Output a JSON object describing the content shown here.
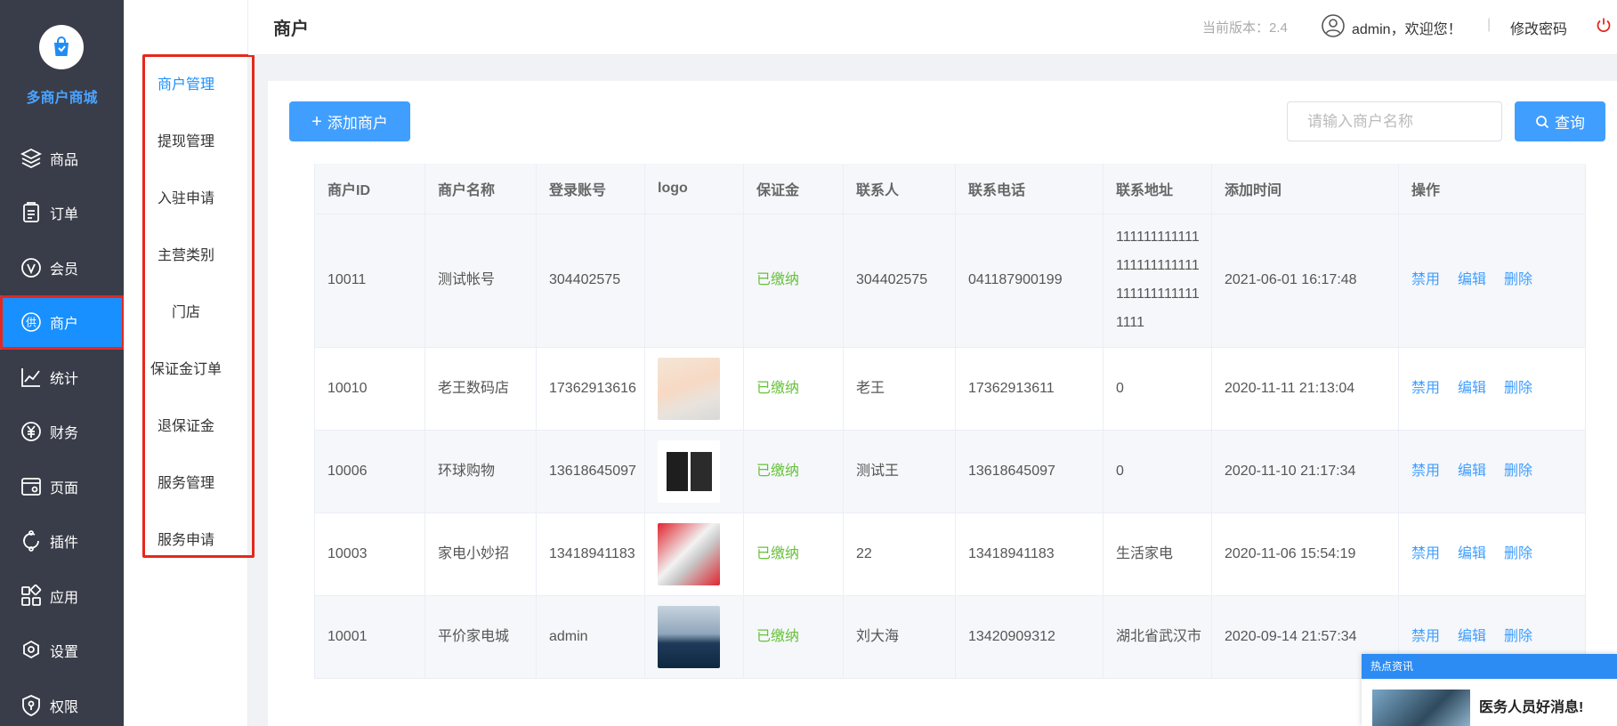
{
  "app": {
    "title": "多商户商城"
  },
  "sidebar": {
    "items": [
      {
        "label": "商品",
        "icon": "layers-icon"
      },
      {
        "label": "订单",
        "icon": "clipboard-icon"
      },
      {
        "label": "会员",
        "icon": "vip-icon"
      },
      {
        "label": "商户",
        "icon": "supplier-icon",
        "active": true
      },
      {
        "label": "统计",
        "icon": "chart-icon"
      },
      {
        "label": "财务",
        "icon": "yen-icon"
      },
      {
        "label": "页面",
        "icon": "window-icon"
      },
      {
        "label": "插件",
        "icon": "plugin-icon"
      },
      {
        "label": "应用",
        "icon": "apps-icon"
      },
      {
        "label": "设置",
        "icon": "gear-icon"
      },
      {
        "label": "权限",
        "icon": "shield-icon"
      }
    ]
  },
  "submenu": {
    "items": [
      {
        "label": "商户管理",
        "active": true
      },
      {
        "label": "提现管理"
      },
      {
        "label": "入驻申请"
      },
      {
        "label": "主营类别"
      },
      {
        "label": "门店"
      },
      {
        "label": "保证金订单"
      },
      {
        "label": "退保证金"
      },
      {
        "label": "服务管理"
      },
      {
        "label": "服务申请"
      }
    ]
  },
  "header": {
    "title": "商户",
    "version": "当前版本：2.4",
    "user": "admin，欢迎您！",
    "separator": "|",
    "change_password": "修改密码"
  },
  "toolbar": {
    "add_label": "添加商户",
    "search_placeholder": "请输入商户名称",
    "search_label": "查询"
  },
  "table": {
    "columns": [
      "商户ID",
      "商户名称",
      "登录账号",
      "logo",
      "保证金",
      "联系人",
      "联系电话",
      "联系地址",
      "添加时间",
      "操作"
    ],
    "actions": {
      "disable": "禁用",
      "edit": "编辑",
      "delete": "删除"
    },
    "rows": [
      {
        "id": "10011",
        "name": "测试帐号",
        "account": "304402575",
        "deposit": "已缴纳",
        "contact": "304402575",
        "phone": "041187900199",
        "address": "1111111111111111111111111111111111111111",
        "time": "2021-06-01 16:17:48"
      },
      {
        "id": "10010",
        "name": "老王数码店",
        "account": "17362913616",
        "deposit": "已缴纳",
        "contact": "老王",
        "phone": "17362913611",
        "address": "0",
        "time": "2020-11-11 21:13:04"
      },
      {
        "id": "10006",
        "name": "环球购物",
        "account": "13618645097",
        "deposit": "已缴纳",
        "contact": "测试王",
        "phone": "13618645097",
        "address": "0",
        "time": "2020-11-10 21:17:34"
      },
      {
        "id": "10003",
        "name": "家电小妙招",
        "account": "13418941183",
        "deposit": "已缴纳",
        "contact": "22",
        "phone": "13418941183",
        "address": "生活家电",
        "time": "2020-11-06 15:54:19"
      },
      {
        "id": "10001",
        "name": "平价家电城",
        "account": "admin",
        "deposit": "已缴纳",
        "contact": "刘大海",
        "phone": "13420909312",
        "address": "湖北省武汉市",
        "time": "2020-09-14 21:57:34"
      }
    ]
  },
  "news": {
    "header": "热点资讯",
    "headline": "医务人员好消息!"
  }
}
